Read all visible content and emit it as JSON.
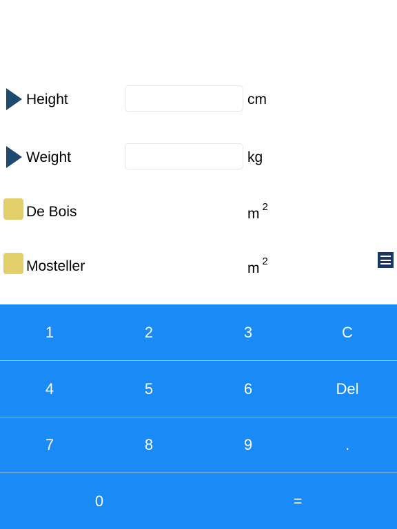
{
  "rows": {
    "height": {
      "label": "Height",
      "value": "",
      "unit": "cm"
    },
    "weight": {
      "label": "Weight",
      "value": "",
      "unit": "kg"
    },
    "debois": {
      "label": "De Bois",
      "unit": "m",
      "unit_sup": "2"
    },
    "mosteller": {
      "label": "Mosteller",
      "unit": "m",
      "unit_sup": "2"
    }
  },
  "colors": {
    "triangle": "#1f4a70",
    "square": "#e3cf6a",
    "keypad": "#1a8af7",
    "menu": "#1c3461"
  },
  "icons": {
    "height_marker": "play-triangle-icon",
    "weight_marker": "play-triangle-icon",
    "result_marker": "square-icon",
    "menu": "hamburger-menu-icon"
  },
  "keypad": {
    "k1": "1",
    "k2": "2",
    "k3": "3",
    "clear": "C",
    "k4": "4",
    "k5": "5",
    "k6": "6",
    "del": "Del",
    "k7": "7",
    "k8": "8",
    "k9": "9",
    "dot": ".",
    "k0": "0",
    "equals": "="
  }
}
